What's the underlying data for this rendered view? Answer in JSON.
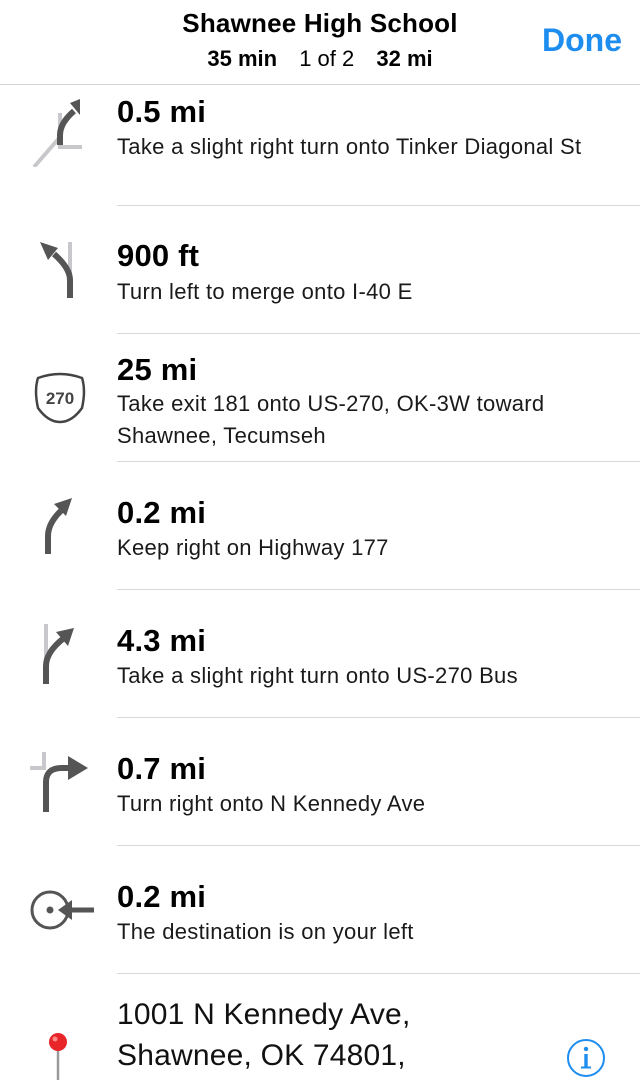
{
  "header": {
    "title": "Shawnee High School",
    "duration": "35 min",
    "route_index": "1 of 2",
    "distance": "32 mi",
    "done_label": "Done"
  },
  "steps": [
    {
      "distance": "0.5 mi",
      "instruction": "Take a slight right turn onto Tinker Diagonal St",
      "icon": "slight-right-turn-icon"
    },
    {
      "distance": "900 ft",
      "instruction": "Turn left to merge onto I-40 E",
      "icon": "merge-left-icon"
    },
    {
      "distance": "25 mi",
      "instruction": "Take exit 181 onto US-270, OK-3W toward Shawnee, Tecumseh",
      "icon": "us-270-shield-icon",
      "shield_number": "270"
    },
    {
      "distance": "0.2 mi",
      "instruction": "Keep right on Highway 177",
      "icon": "keep-right-icon"
    },
    {
      "distance": "4.3 mi",
      "instruction": "Take a slight right turn onto US-270 Bus",
      "icon": "slight-right-turn-icon"
    },
    {
      "distance": "0.7 mi",
      "instruction": "Turn right onto N Kennedy Ave",
      "icon": "right-turn-icon"
    },
    {
      "distance": "0.2 mi",
      "instruction": "The destination is on your left",
      "icon": "destination-left-icon"
    }
  ],
  "destination": {
    "address_line1": "1001 N Kennedy Ave,",
    "address_line2": "Shawnee, OK  74801,",
    "icon": "map-pin-icon",
    "info_icon": "info-icon"
  },
  "colors": {
    "accent": "#1e8df0",
    "icon_gray": "#555555",
    "icon_light": "#c8c8cc",
    "pin_red": "#e8262a"
  }
}
